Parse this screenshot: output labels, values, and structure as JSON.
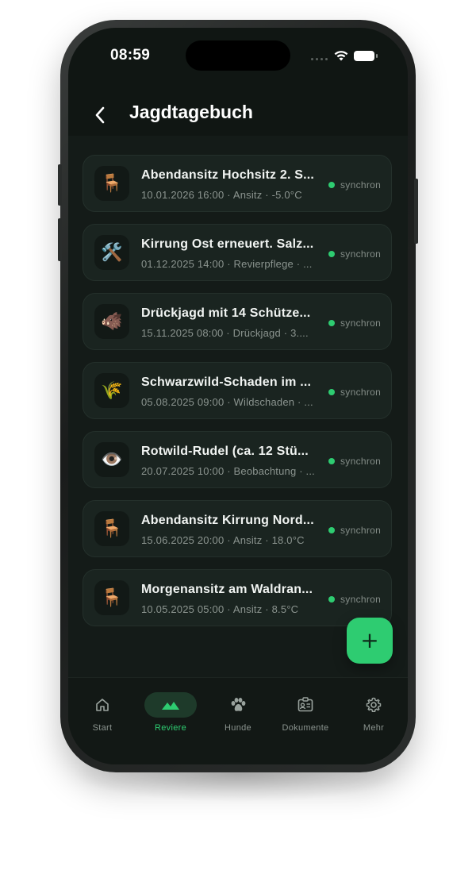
{
  "status_bar": {
    "time": "08:59"
  },
  "header": {
    "title": "Jagdtagebuch",
    "back_icon": "chevron-left-icon"
  },
  "entries": [
    {
      "icon": "🪑",
      "icon_name": "chair-icon",
      "title": "Abendansitz Hochsitz 2. S...",
      "subtitle": "10.01.2026 16:00 · Ansitz · -5.0°C",
      "status": "synchron"
    },
    {
      "icon": "🛠️",
      "icon_name": "tools-icon",
      "title": "Kirrung Ost erneuert. Salz...",
      "subtitle": "01.12.2025 14:00 · Revierpflege · ...",
      "status": "synchron"
    },
    {
      "icon": "🐗",
      "icon_name": "boar-icon",
      "title": "Drückjagd mit 14 Schütze...",
      "subtitle": "15.11.2025 08:00 · Drückjagd · 3....",
      "status": "synchron"
    },
    {
      "icon": "🌾",
      "icon_name": "wheat-icon",
      "title": "Schwarzwild-Schaden im ...",
      "subtitle": "05.08.2025 09:00 · Wildschaden · ...",
      "status": "synchron"
    },
    {
      "icon": "👁️",
      "icon_name": "eye-icon",
      "title": "Rotwild-Rudel (ca. 12 Stü...",
      "subtitle": "20.07.2025 10:00 · Beobachtung · ...",
      "status": "synchron"
    },
    {
      "icon": "🪑",
      "icon_name": "chair-icon",
      "title": "Abendansitz Kirrung Nord...",
      "subtitle": "15.06.2025 20:00 · Ansitz · 18.0°C",
      "status": "synchron"
    },
    {
      "icon": "🪑",
      "icon_name": "chair-icon",
      "title": "Morgenansitz am Waldran...",
      "subtitle": "10.05.2025 05:00 · Ansitz · 8.5°C",
      "status": "synchron"
    }
  ],
  "fab": {
    "label": "+",
    "icon": "plus-icon"
  },
  "tabbar": {
    "items": [
      {
        "label": "Start",
        "icon": "home-icon",
        "active": false
      },
      {
        "label": "Reviere",
        "icon": "mountain-icon",
        "active": true
      },
      {
        "label": "Hunde",
        "icon": "paw-icon",
        "active": false
      },
      {
        "label": "Dokumente",
        "icon": "id-card-icon",
        "active": false
      },
      {
        "label": "Mehr",
        "icon": "gear-icon",
        "active": false
      }
    ]
  },
  "colors": {
    "accent": "#2ecc71",
    "background": "#141b18",
    "card": "#1a2420"
  }
}
